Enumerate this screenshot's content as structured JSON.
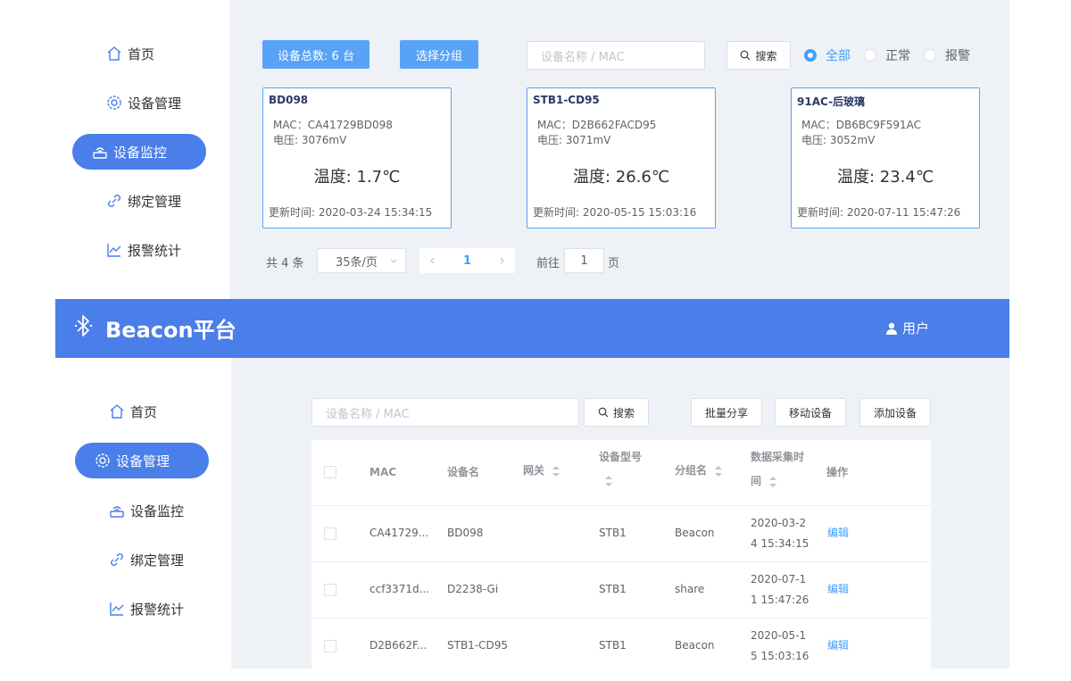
{
  "top": {
    "nav": [
      {
        "label": "首页",
        "icon": "home-icon"
      },
      {
        "label": "设备管理",
        "icon": "gear-icon"
      },
      {
        "label": "设备监控",
        "icon": "router-icon",
        "active": true
      },
      {
        "label": "绑定管理",
        "icon": "link-icon"
      },
      {
        "label": "报警统计",
        "icon": "chart-line-icon"
      }
    ],
    "toolbar": {
      "total_label": "设备总数: 6 台",
      "group_label": "选择分组",
      "search_placeholder": "设备名称 / MAC",
      "search_button": "搜索",
      "filters": [
        "全部",
        "正常",
        "报警"
      ],
      "selected_filter": "全部"
    },
    "cards": [
      {
        "name": "BD098",
        "mac": "MAC：CA41729BD098",
        "voltage": "电压: 3076mV",
        "temp": "温度: 1.7℃",
        "updated": "更新时间: 2020-03-24 15:34:15"
      },
      {
        "name": "STB1-CD95",
        "mac": "MAC：D2B662FACD95",
        "voltage": "电压: 3071mV",
        "temp": "温度: 26.6℃",
        "updated": "更新时间: 2020-05-15 15:03:16"
      },
      {
        "name": "91AC-后玻璃",
        "mac": "MAC：DB6BC9F591AC",
        "voltage": "电压: 3052mV",
        "temp": "温度: 23.4℃",
        "updated": "更新时间: 2020-07-11 15:47:26"
      }
    ],
    "pager": {
      "total": "共 4 条",
      "page_size": "35条/页",
      "current": "1",
      "goto_label": "前往",
      "goto_value": "1",
      "page_suffix": "页"
    }
  },
  "header": {
    "brand": "Beacon平台",
    "user": "用户",
    "accent": "#4a7ee8"
  },
  "bottom": {
    "nav": [
      {
        "label": "首页",
        "icon": "home-icon"
      },
      {
        "label": "设备管理",
        "icon": "gear-icon",
        "active": true
      },
      {
        "label": "设备监控",
        "icon": "router-icon"
      },
      {
        "label": "绑定管理",
        "icon": "link-icon"
      },
      {
        "label": "报警统计",
        "icon": "chart-line-icon"
      }
    ],
    "toolbar": {
      "search_placeholder": "设备名称 / MAC",
      "search_button": "搜索",
      "batch_share": "批量分享",
      "move_device": "移动设备",
      "add_device": "添加设备"
    },
    "table": {
      "headers": {
        "mac": "MAC",
        "name": "设备名",
        "gateway": "网关",
        "model": "设备型号",
        "group": "分组名",
        "time_l1": "数据采集时",
        "time_l2": "间",
        "action": "操作"
      },
      "rows": [
        {
          "mac": "CA41729...",
          "name": "BD098",
          "gateway": "",
          "model": "STB1",
          "group": "Beacon",
          "time_l1": "2020-03-2",
          "time_l2": "4 15:34:15",
          "action": "编辑"
        },
        {
          "mac": "ccf3371d...",
          "name": "D2238-Gi",
          "gateway": "",
          "model": "STB1",
          "group": "share",
          "time_l1": "2020-07-1",
          "time_l2": "1 15:47:26",
          "action": "编辑"
        },
        {
          "mac": "D2B662F...",
          "name": "STB1-CD95",
          "gateway": "",
          "model": "STB1",
          "group": "Beacon",
          "time_l1": "2020-05-1",
          "time_l2": "5 15:03:16",
          "action": "编辑"
        }
      ]
    }
  }
}
